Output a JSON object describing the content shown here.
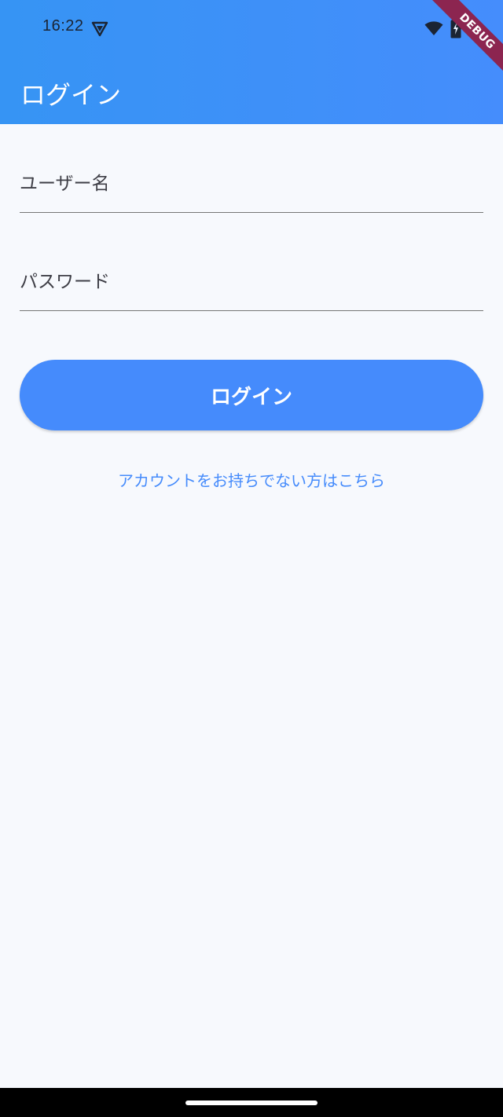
{
  "status_bar": {
    "time": "16:22",
    "icons": [
      "vpn-icon",
      "wifi-icon",
      "battery-charging-icon"
    ]
  },
  "debug_banner": {
    "label": "DEBUG"
  },
  "appbar": {
    "title": "ログイン"
  },
  "form": {
    "username_label": "ユーザー名",
    "password_label": "パスワード",
    "login_button_label": "ログイン",
    "register_link_label": "アカウントをお持ちでない方はこちら"
  },
  "colors": {
    "primary": "#458BFC",
    "appbar_start": "#3694F4",
    "appbar_end": "#458DFC",
    "background": "#F7F9FD",
    "debug_ribbon": "#8C2550"
  }
}
